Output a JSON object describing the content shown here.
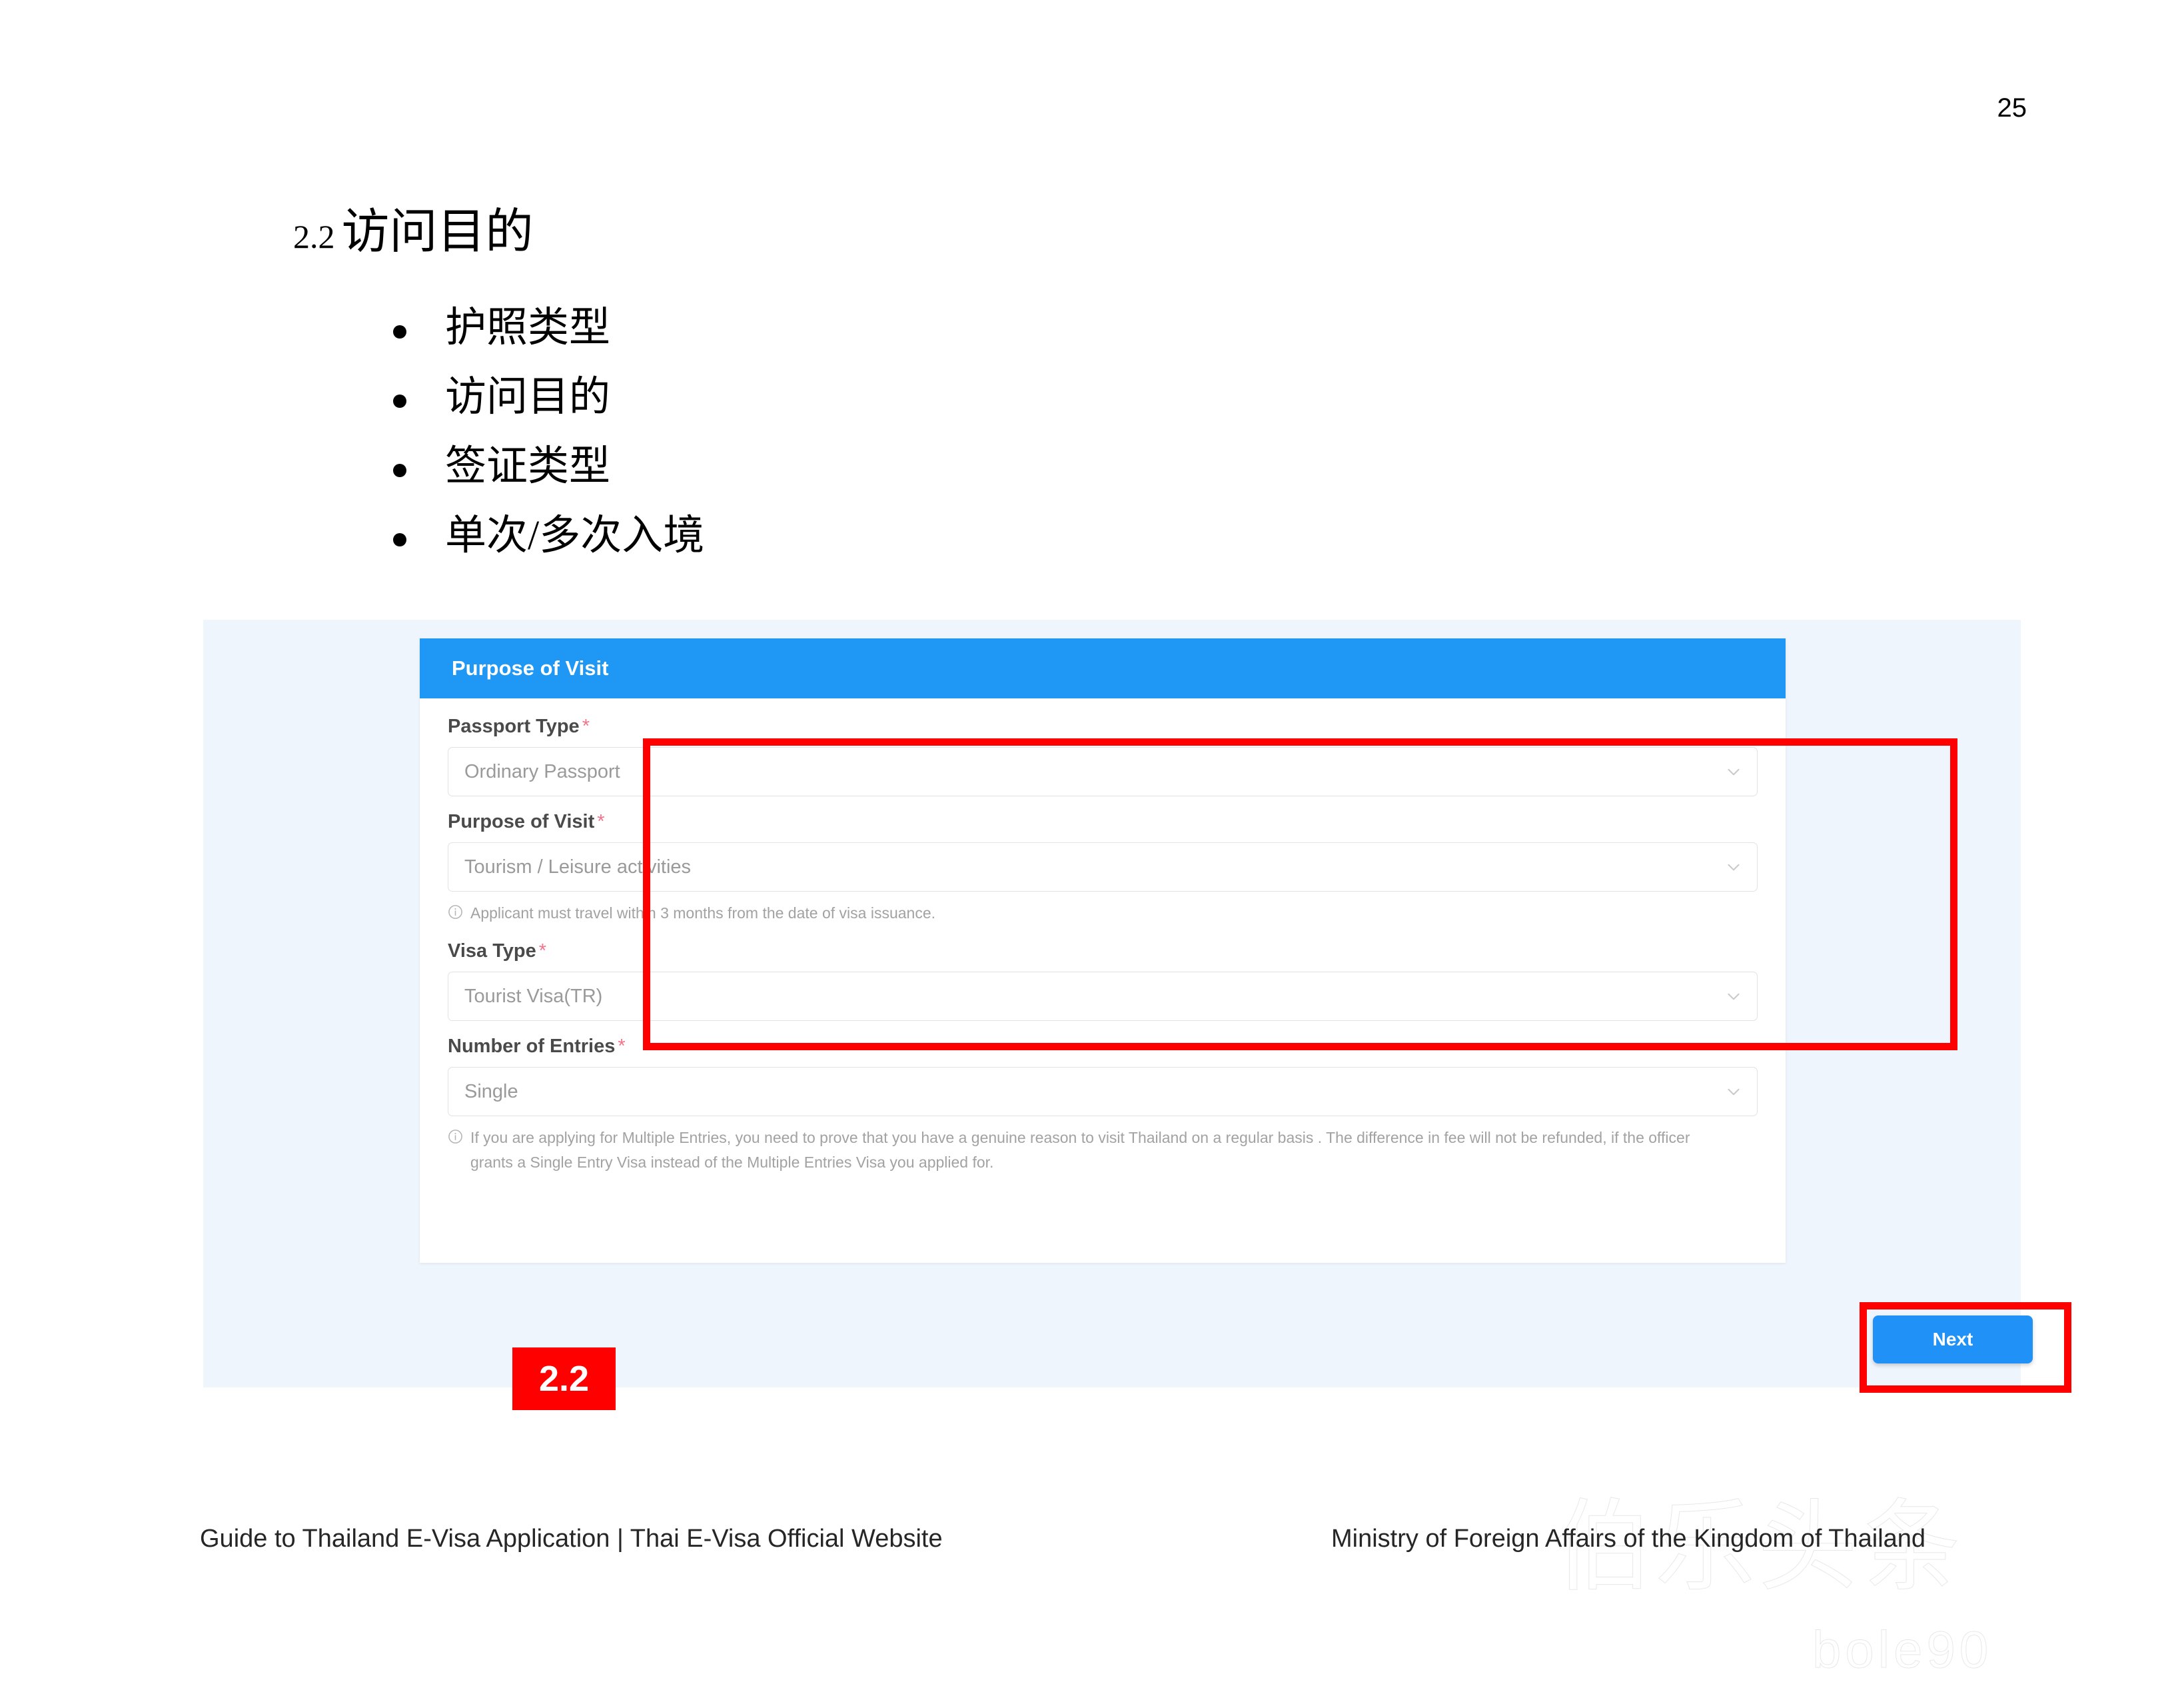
{
  "slide": {
    "page_number": "25",
    "heading_number": "2.2",
    "heading_text": "访问目的",
    "bullets": [
      "护照类型",
      "访问目的",
      "签证类型",
      "单次/多次入境"
    ],
    "footer_left": "Guide to Thailand E-Visa Application | Thai E-Visa Official Website",
    "footer_right": "Ministry of Foreign Affairs of the Kingdom of Thailand"
  },
  "annotation": {
    "badge_label": "2.2",
    "badge_color": "#ff0000",
    "box_color": "#ff0000"
  },
  "form": {
    "header_title": "Purpose of Visit",
    "header_color": "#1f97f5",
    "required_marker": "*",
    "fields": [
      {
        "label": "Passport Type",
        "value": "Ordinary Passport",
        "hint": ""
      },
      {
        "label": "Purpose of Visit",
        "value": "Tourism / Leisure activities",
        "hint": "Applicant must travel within 3 months from the date of visa issuance."
      },
      {
        "label": "Visa Type",
        "value": "Tourist Visa(TR)",
        "hint": ""
      },
      {
        "label": "Number of Entries",
        "value": "Single",
        "hint": "If you are applying for Multiple Entries, you need to prove that you have a genuine reason to visit Thailand on a regular basis . The difference in fee will not be refunded, if the officer grants a Single Entry Visa instead of the Multiple Entries Visa you applied for."
      }
    ],
    "next_label": "Next",
    "next_color": "#1f91f7"
  },
  "watermark": {
    "chinese": "伯乐头条",
    "english": "bole90"
  }
}
